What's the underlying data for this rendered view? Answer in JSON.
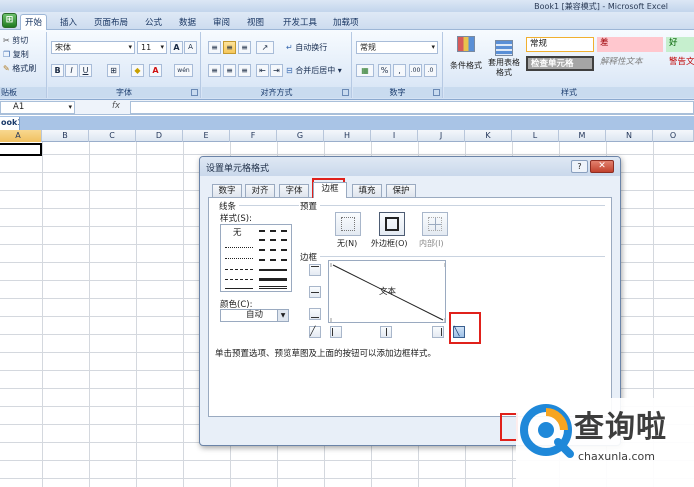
{
  "window": {
    "title": "Book1 [兼容模式] - Microsoft Excel"
  },
  "ribbon": {
    "office_button": "⊞",
    "tabs": [
      "开始",
      "插入",
      "页面布局",
      "公式",
      "数据",
      "审阅",
      "视图",
      "开发工具",
      "加载项"
    ],
    "active_tab": "开始",
    "clipboard": {
      "label": "贴板",
      "cut": "剪切",
      "copy": "复制",
      "format_painter": "格式刷"
    },
    "font": {
      "label": "字体",
      "name": "宋体",
      "size": "11",
      "grow": "A",
      "shrink": "A",
      "bold": "B",
      "italic": "I",
      "underline": "U",
      "font_color_letter": "A",
      "phonetic": "wén"
    },
    "alignment": {
      "label": "对齐方式",
      "wrap": "自动换行",
      "merge": "合并后居中"
    },
    "number": {
      "label": "数字",
      "format": "常规",
      "currency": "%",
      "comma": ",",
      "inc": ".00",
      "dec": ".0"
    },
    "styles": {
      "label": "样式",
      "conditional": "条件格式",
      "as_table": "套用表格格式",
      "normal": "常规",
      "bad": "差",
      "good": "好",
      "check_cell": "检查单元格",
      "explanatory": "解释性文本",
      "warning": "警告文"
    }
  },
  "formula_bar": {
    "name_box": "A1",
    "fx": "fx",
    "value": ""
  },
  "workbook_tab": "ook1",
  "columns": [
    "A",
    "B",
    "C",
    "D",
    "E",
    "F",
    "G",
    "H",
    "I",
    "J",
    "K",
    "L",
    "M",
    "N",
    "O"
  ],
  "dialog": {
    "title": "设置单元格格式",
    "help": "?",
    "close": "✕",
    "tabs": [
      "数字",
      "对齐",
      "字体",
      "边框",
      "填充",
      "保护"
    ],
    "active_tab": "边框",
    "line_section": "线条",
    "style_label": "样式(S):",
    "none_style": "无",
    "color_label": "颜色(C):",
    "color_value": "自动",
    "presets_section": "预置",
    "preset_none": "无(N)",
    "preset_outline": "外边框(O)",
    "preset_inside": "内部(I)",
    "border_section": "边框",
    "preview_text": "文本",
    "hint": "单击预置选项、预览草图及上面的按钮可以添加边框样式。"
  },
  "watermark": {
    "text": "查询啦",
    "url": "chaxunla.com"
  },
  "colors": {
    "highlight_red": "#e0211b",
    "accent_blue": "#1f88d9",
    "selected_gold": "#f6c75a"
  }
}
